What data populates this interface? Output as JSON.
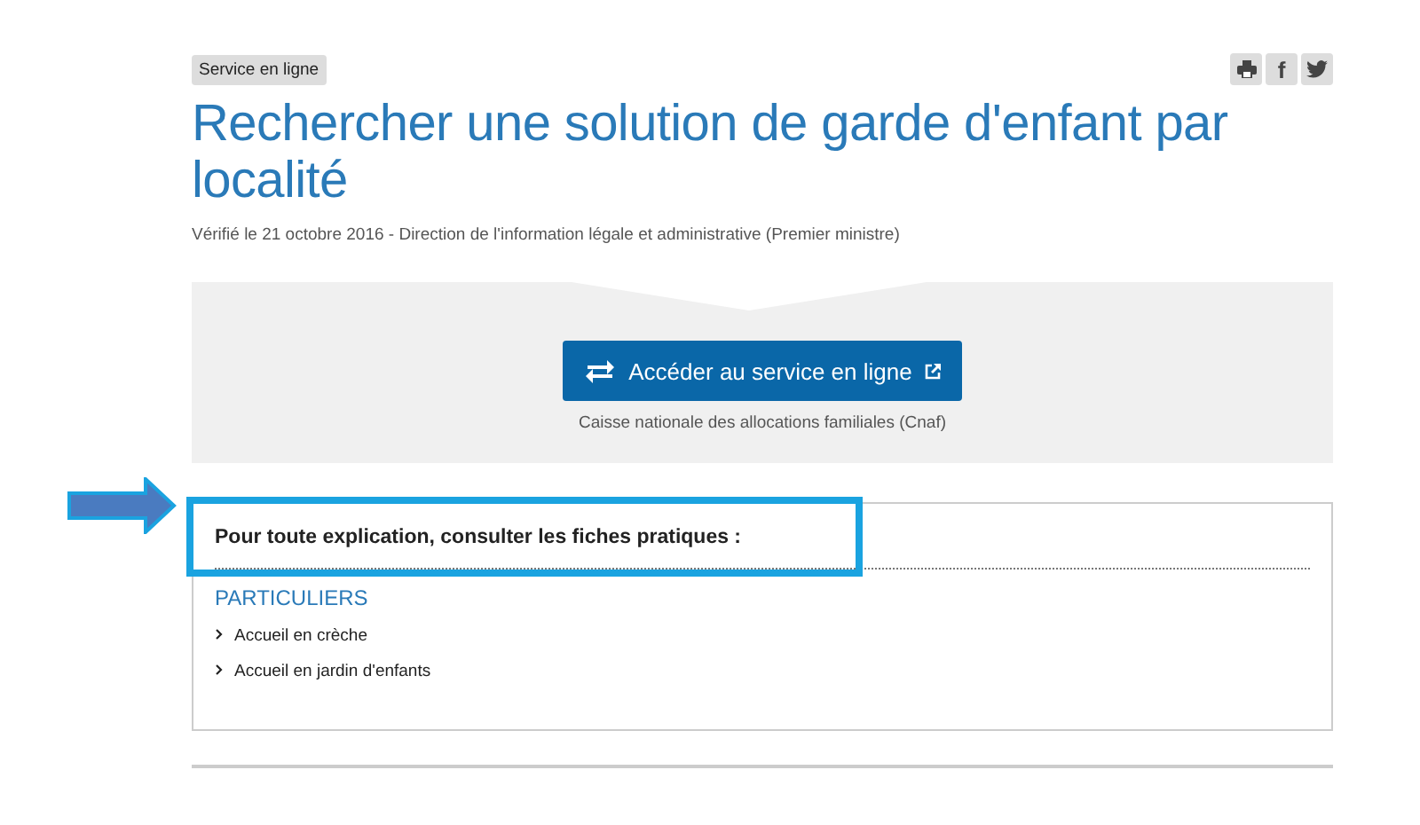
{
  "tag": "Service en ligne",
  "share": [
    {
      "kind": "print"
    },
    {
      "kind": "text",
      "label": "f"
    },
    {
      "kind": "bird"
    }
  ],
  "title": "Rechercher une solution de garde d'enfant par localité",
  "verified": "Vérifié le 21 octobre 2016 - Direction de l'information légale et administrative (Premier ministre)",
  "service": {
    "button": "Accéder au service en ligne",
    "caption": "Caisse nationale des allocations familiales (Cnaf)"
  },
  "card": {
    "heading": "Pour toute explication, consulter les fiches pratiques :",
    "highlighted": true,
    "section": "PARTICULIERS",
    "links": [
      "Accueil en crèche",
      "Accueil en jardin d'enfants"
    ]
  }
}
